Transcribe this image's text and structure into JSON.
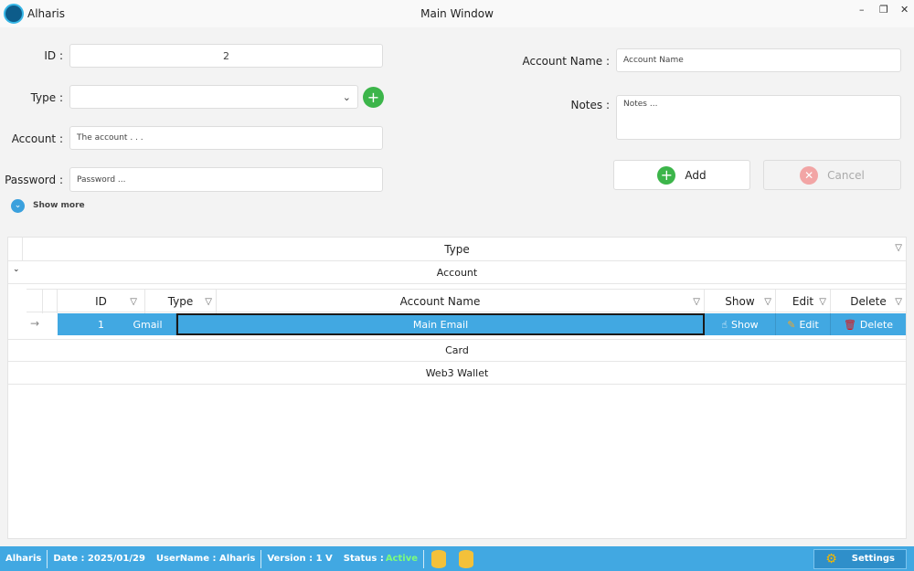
{
  "window": {
    "app_name": "Alharis",
    "title": "Main Window",
    "minimize": "–",
    "restore": "❐",
    "close": "✕"
  },
  "form": {
    "id_label": "ID :",
    "id_value": "2",
    "type_label": "Type :",
    "type_value": "",
    "account_label": "Account :",
    "account_placeholder": "The account . . .",
    "password_label": "Password :",
    "password_placeholder": "Password ...",
    "show_more": "Show more",
    "account_name_label": "Account Name :",
    "account_name_placeholder": "Account Name",
    "notes_label": "Notes :",
    "notes_placeholder": "Notes ...",
    "add_label": "Add",
    "cancel_label": "Cancel"
  },
  "grid": {
    "group_header": "Type",
    "groups": [
      "Account",
      "Card",
      "Web3 Wallet"
    ],
    "columns": [
      "ID",
      "Type",
      "Account Name",
      "Show",
      "Edit",
      "Delete"
    ],
    "rows": [
      {
        "id": "1",
        "type": "Gmail",
        "account_name": "Main Email",
        "show": "Show",
        "edit": "Edit",
        "delete": "Delete"
      }
    ]
  },
  "status": {
    "app": "Alharis",
    "date": "Date : 2025/01/29",
    "username": "UserName : Alharis",
    "version": "Version : 1 V",
    "status_label": "Status :",
    "status_value": "Active",
    "settings": "Settings",
    "active_color": "#7CFC7C"
  }
}
